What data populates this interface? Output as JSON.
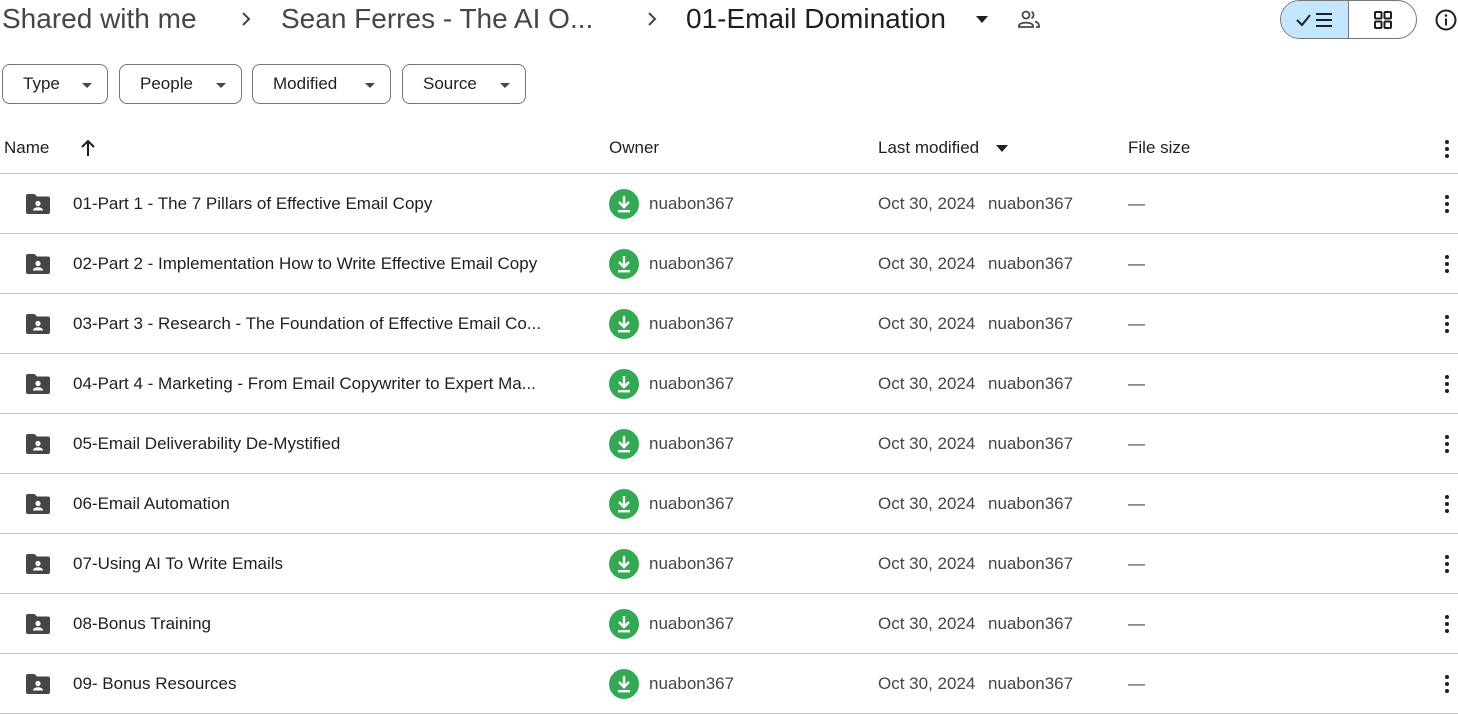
{
  "breadcrumb": {
    "items": [
      "Shared with me",
      "Sean Ferres - The AI O...",
      "01-Email Domination"
    ],
    "icons": {
      "separator": "chevron-right-icon",
      "dropdown": "arrow-drop-down-icon",
      "shared": "people-icon"
    }
  },
  "view_toggle": {
    "active": "list",
    "icons": {
      "list": "check-list-icon",
      "grid": "grid-icon"
    }
  },
  "info_icon": "info-icon",
  "filters": [
    {
      "label": "Type"
    },
    {
      "label": "People"
    },
    {
      "label": "Modified"
    },
    {
      "label": "Source"
    }
  ],
  "table": {
    "columns": {
      "name": "Name",
      "owner": "Owner",
      "modified": "Last modified",
      "size": "File size"
    },
    "sort": {
      "column": "name",
      "direction": "ascending"
    },
    "rows": [
      {
        "name": "01-Part 1 - The 7 Pillars of Effective Email Copy",
        "owner": "nuabon367",
        "modified_date": "Oct 30, 2024",
        "modified_by": "nuabon367",
        "size": "—"
      },
      {
        "name": "02-Part 2 - Implementation How to Write Effective Email Copy",
        "owner": "nuabon367",
        "modified_date": "Oct 30, 2024",
        "modified_by": "nuabon367",
        "size": "—"
      },
      {
        "name": "03-Part 3 - Research - The Foundation of Effective Email Co...",
        "owner": "nuabon367",
        "modified_date": "Oct 30, 2024",
        "modified_by": "nuabon367",
        "size": "—"
      },
      {
        "name": "04-Part 4 - Marketing - From Email Copywriter to Expert Ma...",
        "owner": "nuabon367",
        "modified_date": "Oct 30, 2024",
        "modified_by": "nuabon367",
        "size": "—"
      },
      {
        "name": "05-Email Deliverability De-Mystified",
        "owner": "nuabon367",
        "modified_date": "Oct 30, 2024",
        "modified_by": "nuabon367",
        "size": "—"
      },
      {
        "name": "06-Email Automation",
        "owner": "nuabon367",
        "modified_date": "Oct 30, 2024",
        "modified_by": "nuabon367",
        "size": "—"
      },
      {
        "name": "07-Using AI To Write Emails",
        "owner": "nuabon367",
        "modified_date": "Oct 30, 2024",
        "modified_by": "nuabon367",
        "size": "—"
      },
      {
        "name": "08-Bonus Training",
        "owner": "nuabon367",
        "modified_date": "Oct 30, 2024",
        "modified_by": "nuabon367",
        "size": "—"
      },
      {
        "name": "09- Bonus Resources",
        "owner": "nuabon367",
        "modified_date": "Oct 30, 2024",
        "modified_by": "nuabon367",
        "size": "—"
      }
    ]
  },
  "colors": {
    "text_primary": "#1f1f1f",
    "text_secondary": "#444746",
    "toggle_active_bg": "#c2e7ff",
    "avatar_green": "#34a853",
    "divider": "#c7c7c7",
    "outline": "#747775"
  }
}
